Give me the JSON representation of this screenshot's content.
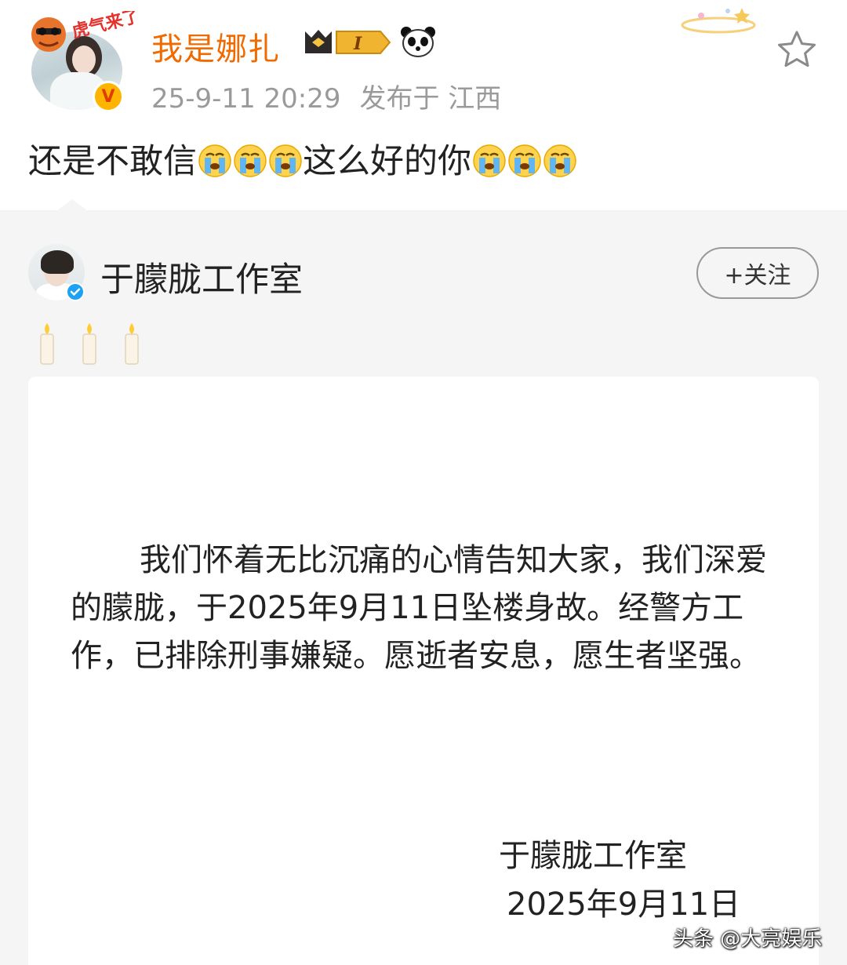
{
  "post": {
    "username": "我是娜扎",
    "timestamp": "25-9-11 20:29",
    "location": "发布于 江西",
    "text_part1": "还是不敢信",
    "text_part2": "这么好的你",
    "emoji_count_each": 3,
    "sticker_text": "虎气来了",
    "badge_level": "I",
    "verified_icon": "v-badge-gold-icon",
    "accent_color": "#f06a00"
  },
  "repost": {
    "account_name": "于朦胧工作室",
    "follow_label": "+关注",
    "candle_count": 3,
    "notice": {
      "body": "我们怀着无比沉痛的心情告知大家，我们深爱的朦胧，于2025年9月11日坠楼身故。经警方工作，已排除刑事嫌疑。愿逝者安息，愿生者坚强。",
      "signature": "于朦胧工作室",
      "date": "2025年9月11日"
    }
  },
  "watermark": "头条 @大亮娱乐"
}
